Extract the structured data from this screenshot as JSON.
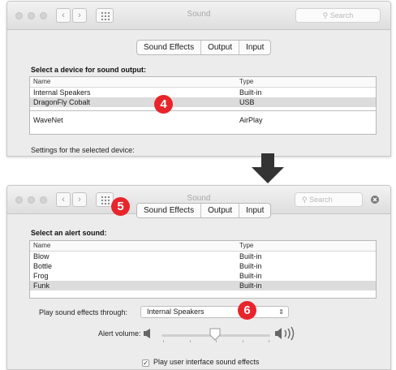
{
  "window1": {
    "title": "Sound",
    "search_placeholder": "Search",
    "tabs": [
      {
        "label": "Sound Effects"
      },
      {
        "label": "Output"
      },
      {
        "label": "Input"
      }
    ],
    "section_title": "Select a device for sound output:",
    "columns": {
      "name": "Name",
      "type": "Type"
    },
    "rows": [
      {
        "name": "Internal Speakers",
        "type": "Built-in"
      },
      {
        "name": "DragonFly Cobalt",
        "type": "USB"
      },
      {
        "name": "WaveNet",
        "type": "AirPlay"
      }
    ],
    "settings_label": "Settings for the selected device:",
    "callout": "4"
  },
  "window2": {
    "title": "Sound",
    "search_placeholder": "Search",
    "tabs": [
      {
        "label": "Sound Effects"
      },
      {
        "label": "Output"
      },
      {
        "label": "Input"
      }
    ],
    "section_title": "Select an alert sound:",
    "columns": {
      "name": "Name",
      "type": "Type"
    },
    "rows": [
      {
        "name": "Blow",
        "type": "Built-in"
      },
      {
        "name": "Bottle",
        "type": "Built-in"
      },
      {
        "name": "Frog",
        "type": "Built-in"
      },
      {
        "name": "Funk",
        "type": "Built-in"
      }
    ],
    "play_through_label": "Play sound effects through:",
    "play_through_value": "Internal Speakers",
    "alert_volume_label": "Alert volume:",
    "alert_volume_level": 0.5,
    "ui_sounds_label": "Play user interface sound effects",
    "ui_sounds_checked": true,
    "callout_tabs": "5",
    "callout_output": "6"
  },
  "colors": {
    "callout": "#e8252b",
    "selected_row": "#dcdcdc",
    "arrow": "#333333"
  }
}
